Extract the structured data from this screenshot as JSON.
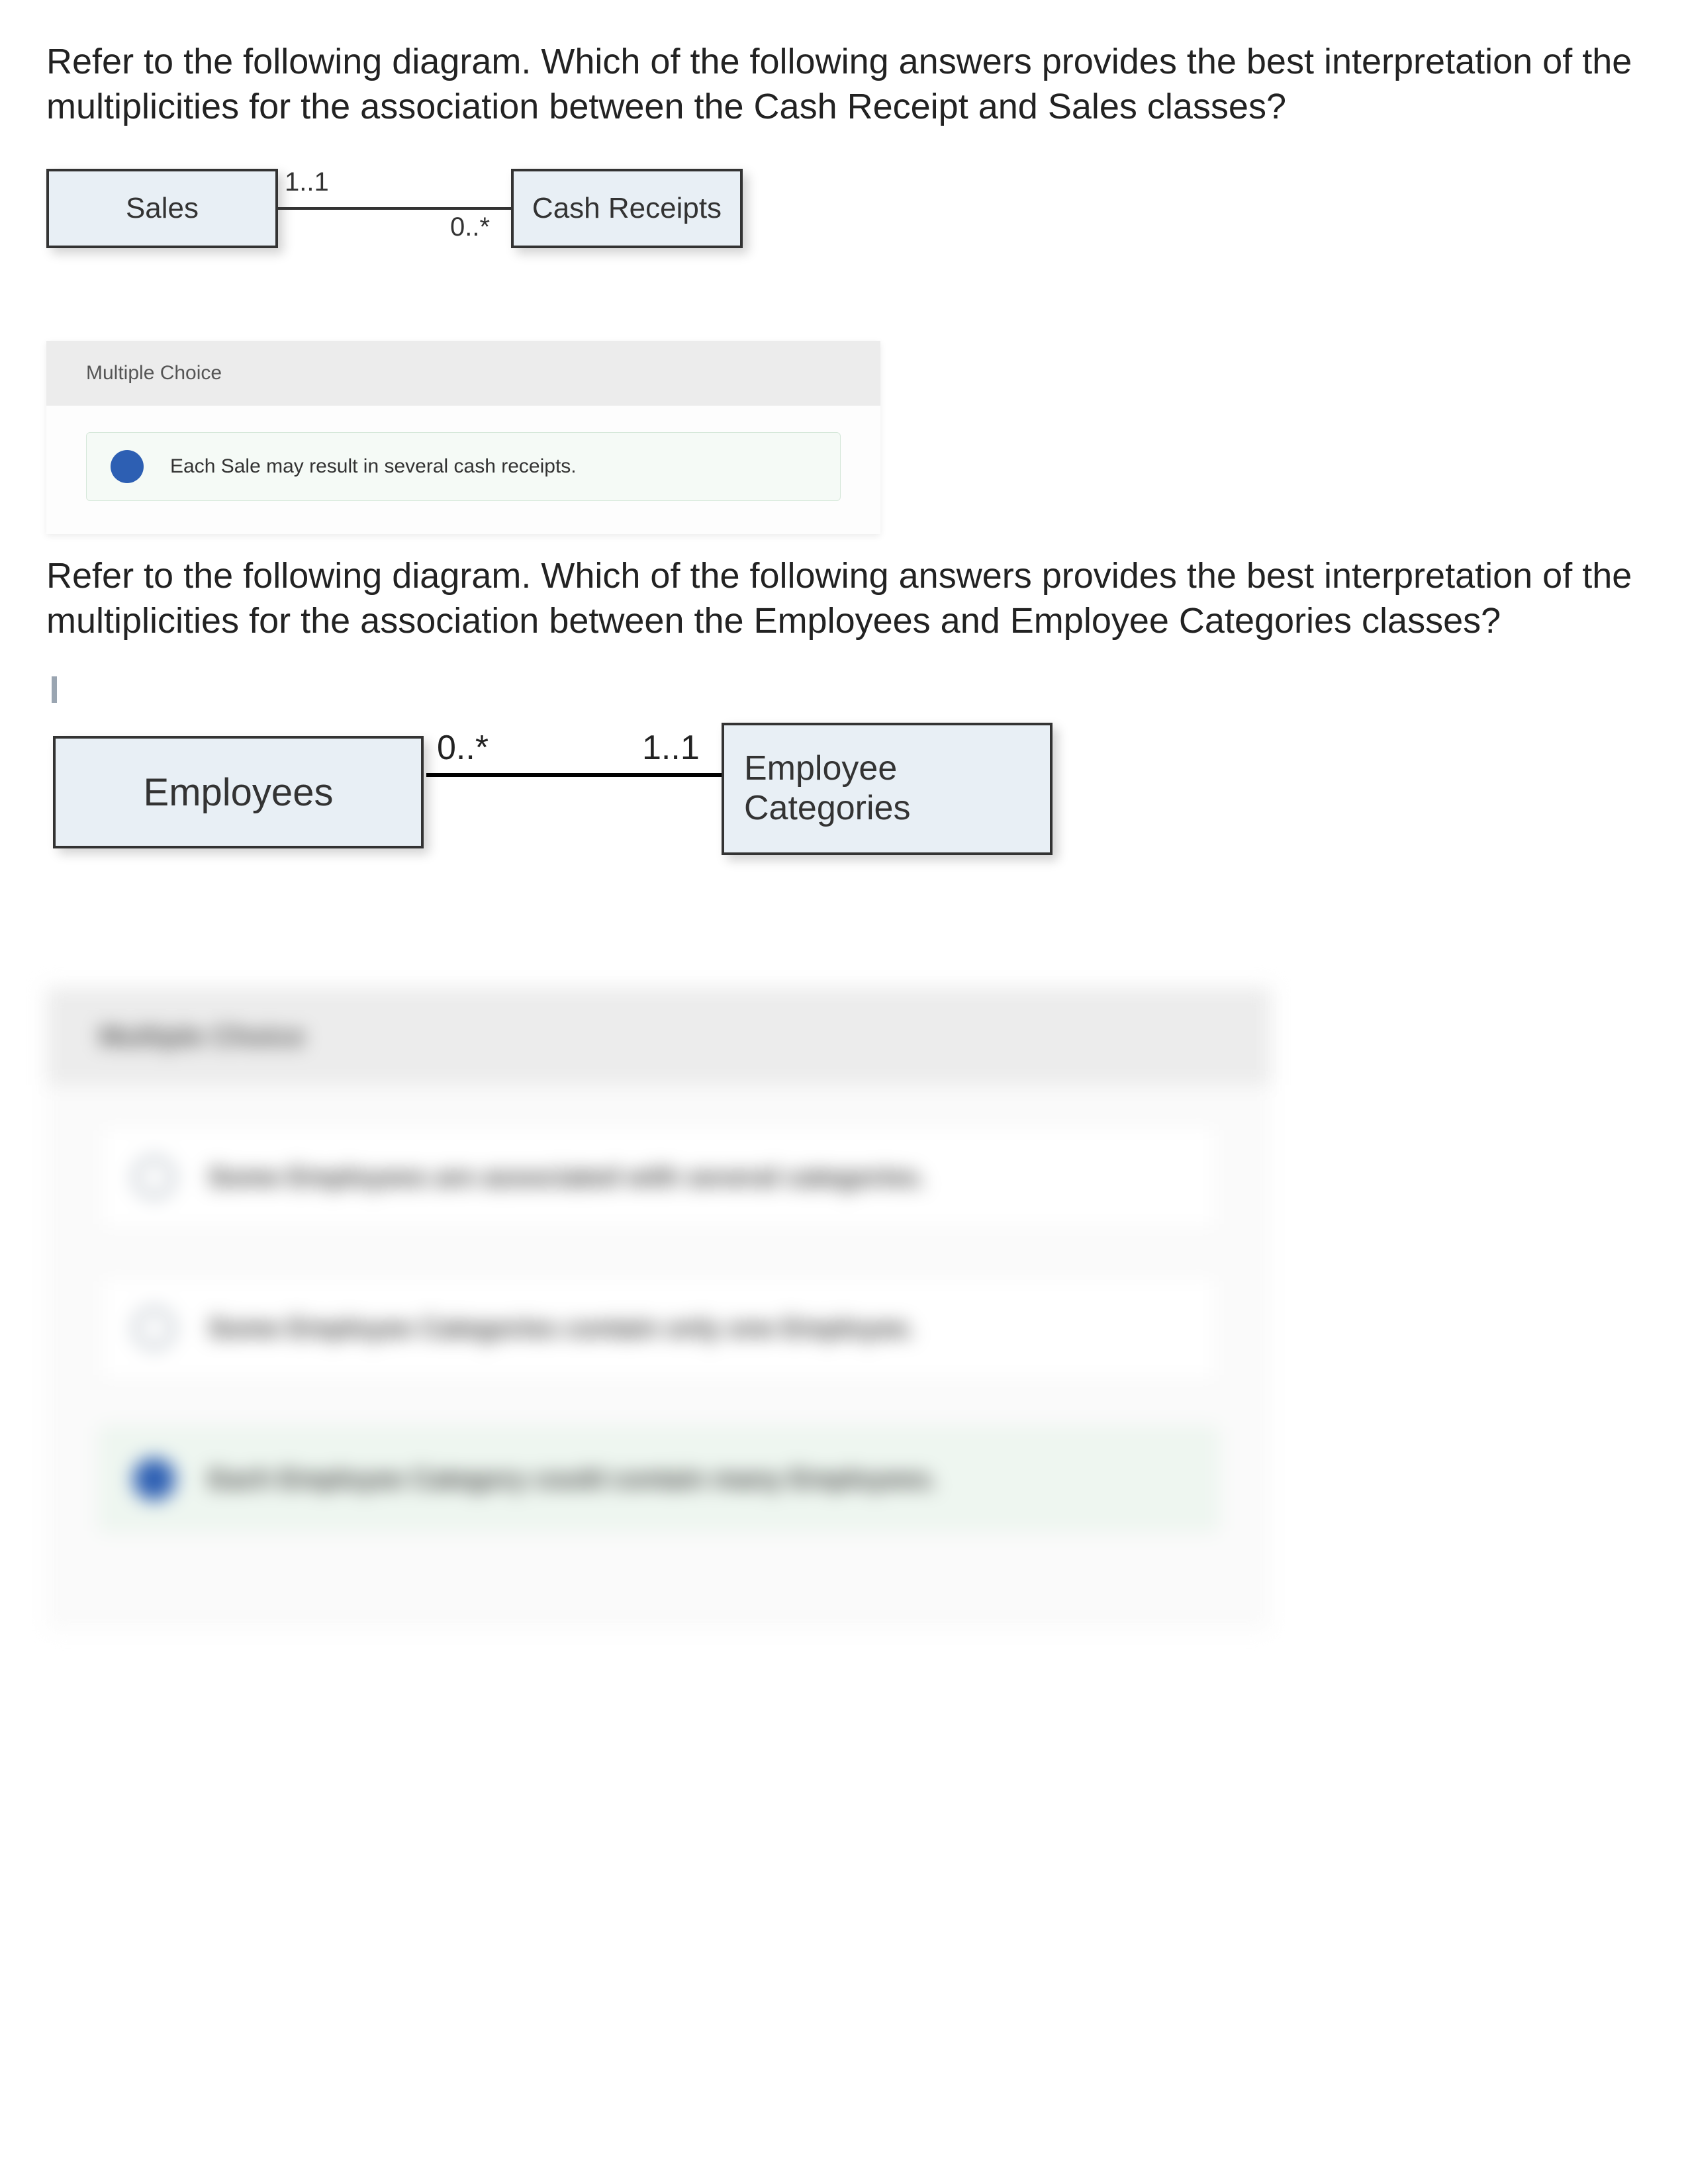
{
  "q1": {
    "prompt": "Refer to the following diagram. Which of the following answers provides the best interpretation of the multiplicities for the association between the Cash Receipt and Sales classes?",
    "uml": {
      "left_class": "Sales",
      "right_class": "Cash Receipts",
      "mult_left": "1..1",
      "mult_right": "0..*"
    },
    "mc_header": "Multiple Choice",
    "selected_option": "Each Sale may result in several cash receipts."
  },
  "q2": {
    "prompt": "Refer to the following diagram. Which of the following answers provides the best interpretation of the multiplicities for the association between the Employees and Employee Categories classes?",
    "uml": {
      "left_class": "Employees",
      "right_class_line1": "Employee",
      "right_class_line2": "Categories",
      "mult_left": "0..*",
      "mult_right": "1..1"
    },
    "mc_header_blur": "Multiple Choice",
    "options_blur": [
      "Some Employees are associated with several categories.",
      "Some Employee Categories contain only one Employee.",
      "Each Employee Category could contain many Employees."
    ]
  }
}
